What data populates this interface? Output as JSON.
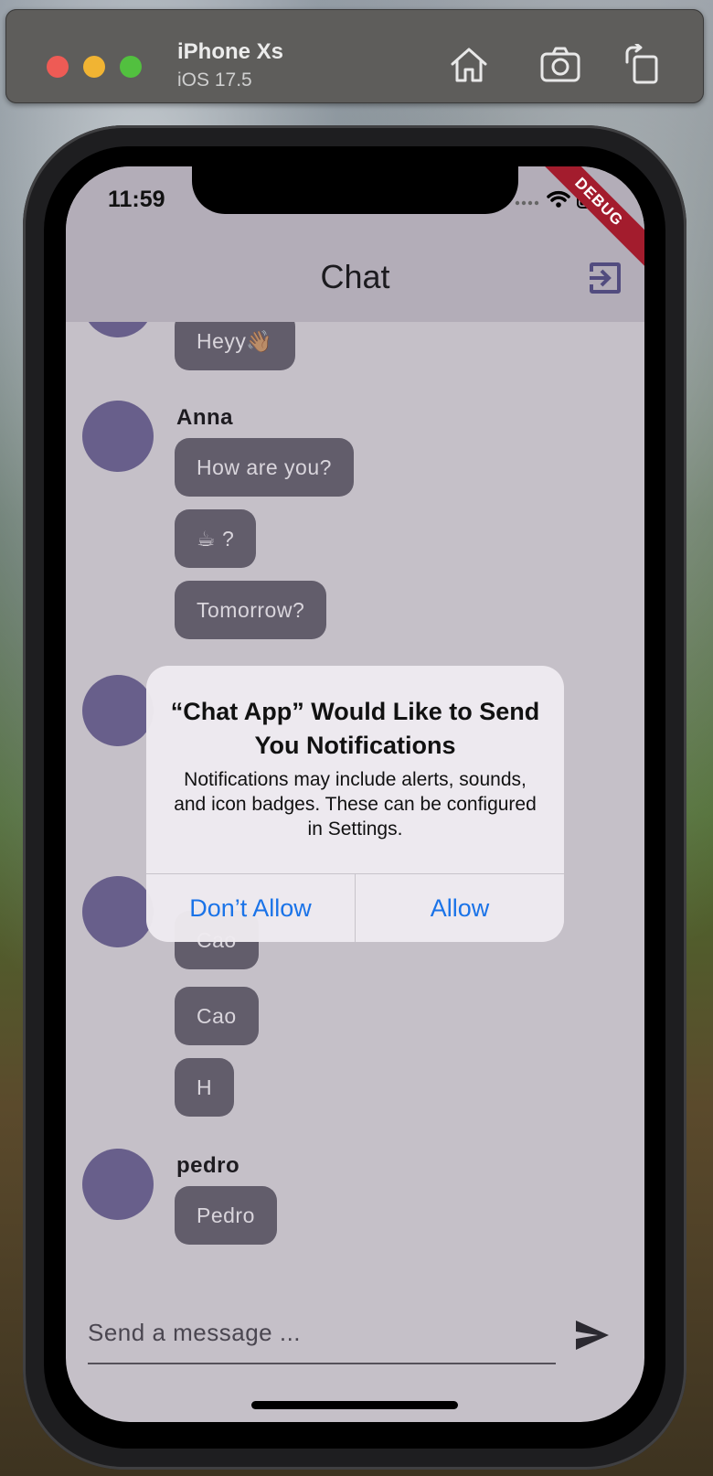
{
  "simulator": {
    "device_name": "iPhone Xs",
    "os_version": "iOS 17.5",
    "toolbar_icons": [
      "home-icon",
      "screenshot-icon",
      "rotate-icon"
    ]
  },
  "status_bar": {
    "time": "11:59",
    "icons": [
      "signal-dots-icon",
      "wifi-icon",
      "battery-icon"
    ]
  },
  "debug_banner": "DEBUG",
  "app_bar": {
    "title": "Chat",
    "action_icon": "logout-icon"
  },
  "messages": [
    {
      "sender": "",
      "bubbles": [
        "Heyy👋🏽"
      ]
    },
    {
      "sender": "Anna",
      "bubbles": [
        "How are you?",
        "☕ ?",
        "Tomorrow?"
      ]
    },
    {
      "sender": "",
      "bubbles": []
    },
    {
      "sender": "",
      "bubbles": [
        "Cao",
        "Cao",
        "H"
      ]
    },
    {
      "sender": "pedro",
      "bubbles": [
        "Pedro"
      ]
    }
  ],
  "composer": {
    "placeholder": "Send a message ...",
    "send_icon": "send-icon"
  },
  "alert": {
    "title": "“Chat App” Would Like to Send You Notifications",
    "message": "Notifications may include alerts, sounds, and icon badges. These can be configured in Settings.",
    "deny_label": "Don’t Allow",
    "allow_label": "Allow"
  },
  "colors": {
    "accent_blue": "#1a73e8",
    "bubble": "#625d6b",
    "avatar": "#685f8b",
    "app_bar": "#b3adb8",
    "background": "#c5c0c8"
  }
}
